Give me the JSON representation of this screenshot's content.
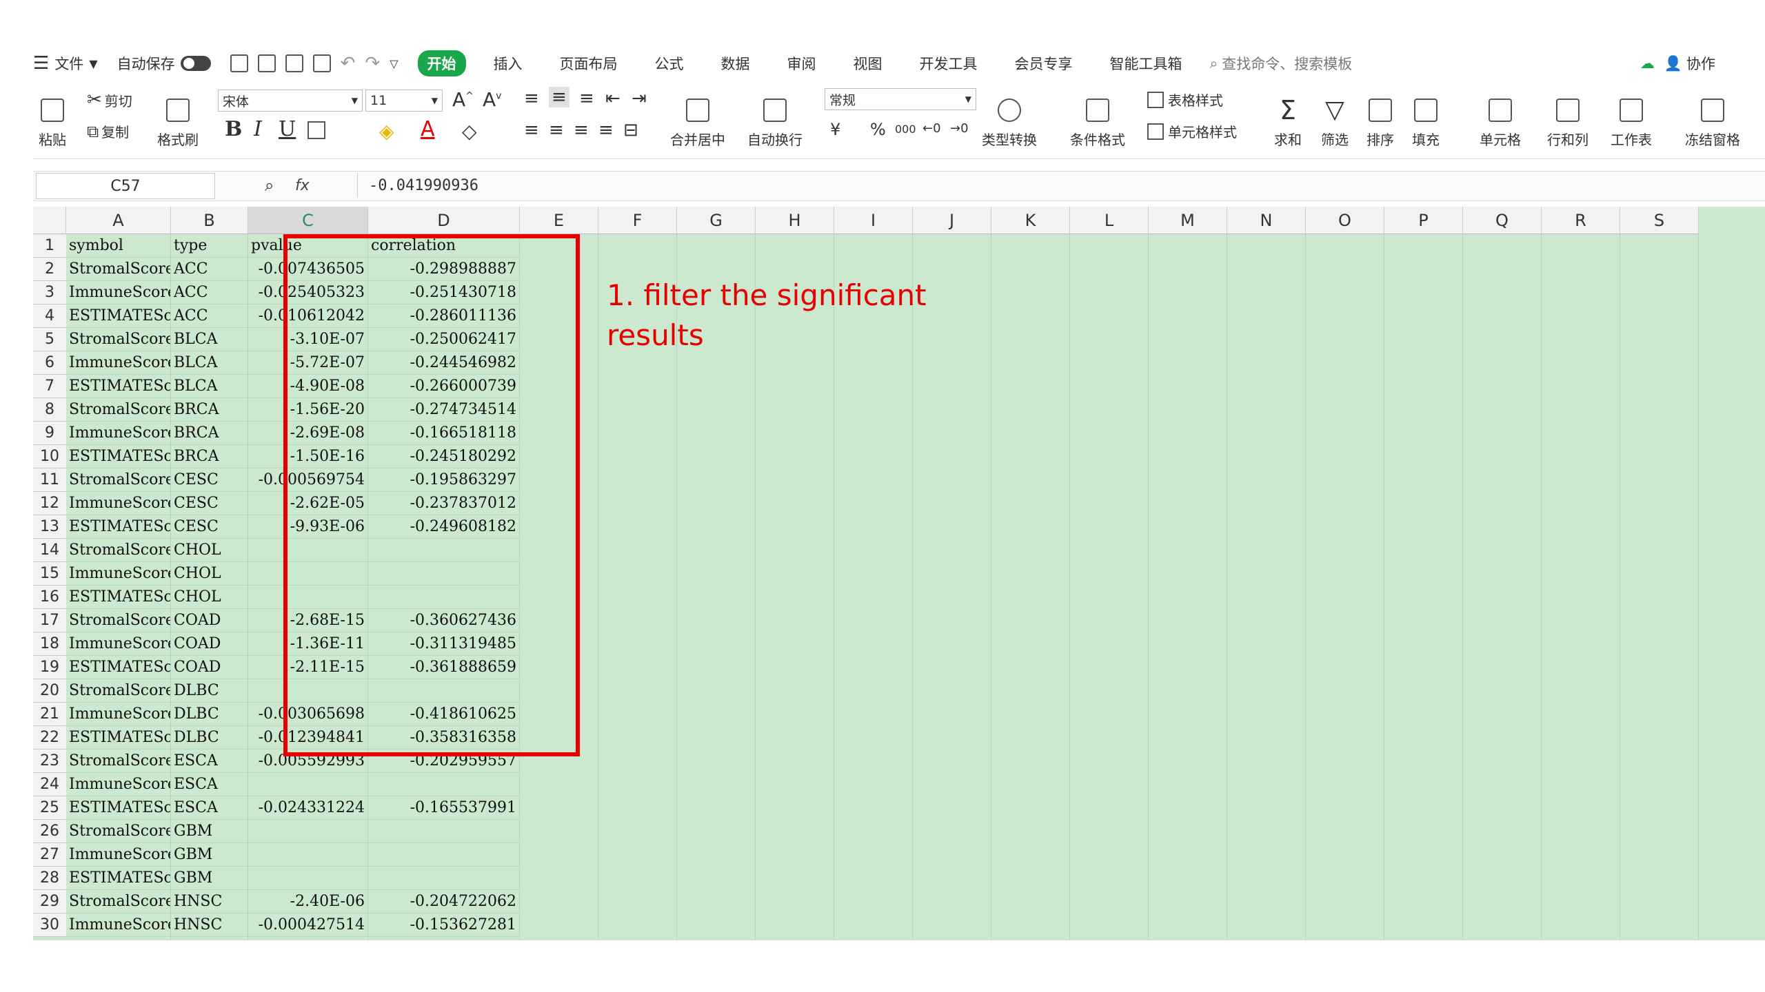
{
  "menu": {
    "file_label": "文件",
    "autosave_label": "自动保存",
    "tabs": [
      "开始",
      "插入",
      "页面布局",
      "公式",
      "数据",
      "审阅",
      "视图",
      "开发工具",
      "会员专享",
      "智能工具箱"
    ],
    "search_placeholder": "查找命令、搜索模板",
    "collab_label": "协作"
  },
  "ribbon": {
    "paste": "粘贴",
    "cut": "剪切",
    "copy": "复制",
    "format_painter": "格式刷",
    "font_name": "宋体",
    "font_size": "11",
    "merge_center": "合并居中",
    "wrap_text": "自动换行",
    "number_format": "常规",
    "type_convert": "类型转换",
    "conditional_format": "条件格式",
    "table_style": "表格样式",
    "cell_style": "单元格样式",
    "sum": "求和",
    "filter": "筛选",
    "sort": "排序",
    "fill": "填充",
    "cell": "单元格",
    "row_col": "行和列",
    "worksheet": "工作表",
    "freeze": "冻结窗格",
    "bold": "B",
    "italic": "I",
    "underline": "U",
    "currency": "¥",
    "percent": "%",
    "thousands": "000"
  },
  "formula_bar": {
    "cell_ref": "C57",
    "fx": "fx",
    "value": "-0.041990936"
  },
  "columns": [
    "A",
    "B",
    "C",
    "D",
    "E",
    "F",
    "G",
    "H",
    "I",
    "J",
    "K",
    "L",
    "M",
    "N",
    "O",
    "P",
    "Q",
    "R",
    "S"
  ],
  "rows": [
    {
      "n": "1",
      "a": "symbol",
      "b": "type",
      "c": "pvalue",
      "d": "correlation"
    },
    {
      "n": "2",
      "a": "StromalScore",
      "b": "ACC",
      "c": "-0.007436505",
      "d": "-0.298988887"
    },
    {
      "n": "3",
      "a": "ImmuneScore",
      "b": "ACC",
      "c": "-0.025405323",
      "d": "-0.251430718"
    },
    {
      "n": "4",
      "a": "ESTIMATEScore",
      "b": "ACC",
      "c": "-0.010612042",
      "d": "-0.286011136"
    },
    {
      "n": "5",
      "a": "StromalScore",
      "b": "BLCA",
      "c": "-3.10E-07",
      "d": "-0.250062417"
    },
    {
      "n": "6",
      "a": "ImmuneScore",
      "b": "BLCA",
      "c": "-5.72E-07",
      "d": "-0.244546982"
    },
    {
      "n": "7",
      "a": "ESTIMATEScore",
      "b": "BLCA",
      "c": "-4.90E-08",
      "d": "-0.266000739"
    },
    {
      "n": "8",
      "a": "StromalScore",
      "b": "BRCA",
      "c": "-1.56E-20",
      "d": "-0.274734514"
    },
    {
      "n": "9",
      "a": "ImmuneScore",
      "b": "BRCA",
      "c": "-2.69E-08",
      "d": "-0.166518118"
    },
    {
      "n": "10",
      "a": "ESTIMATEScore",
      "b": "BRCA",
      "c": "-1.50E-16",
      "d": "-0.245180292"
    },
    {
      "n": "11",
      "a": "StromalScore",
      "b": "CESC",
      "c": "-0.000569754",
      "d": "-0.195863297"
    },
    {
      "n": "12",
      "a": "ImmuneScore",
      "b": "CESC",
      "c": "-2.62E-05",
      "d": "-0.237837012"
    },
    {
      "n": "13",
      "a": "ESTIMATEScore",
      "b": "CESC",
      "c": "-9.93E-06",
      "d": "-0.249608182"
    },
    {
      "n": "14",
      "a": "StromalScore",
      "b": "CHOL",
      "c": "",
      "d": ""
    },
    {
      "n": "15",
      "a": "ImmuneScore",
      "b": "CHOL",
      "c": "",
      "d": ""
    },
    {
      "n": "16",
      "a": "ESTIMATEScore",
      "b": "CHOL",
      "c": "",
      "d": ""
    },
    {
      "n": "17",
      "a": "StromalScore",
      "b": "COAD",
      "c": "-2.68E-15",
      "d": "-0.360627436"
    },
    {
      "n": "18",
      "a": "ImmuneScore",
      "b": "COAD",
      "c": "-1.36E-11",
      "d": "-0.311319485"
    },
    {
      "n": "19",
      "a": "ESTIMATEScore",
      "b": "COAD",
      "c": "-2.11E-15",
      "d": "-0.361888659"
    },
    {
      "n": "20",
      "a": "StromalScore",
      "b": "DLBC",
      "c": "",
      "d": ""
    },
    {
      "n": "21",
      "a": "ImmuneScore",
      "b": "DLBC",
      "c": "-0.003065698",
      "d": "-0.418610625"
    },
    {
      "n": "22",
      "a": "ESTIMATEScore",
      "b": "DLBC",
      "c": "-0.012394841",
      "d": "-0.358316358"
    },
    {
      "n": "23",
      "a": "StromalScore",
      "b": "ESCA",
      "c": "-0.005592993",
      "d": "-0.202959557"
    },
    {
      "n": "24",
      "a": "ImmuneScore",
      "b": "ESCA",
      "c": "",
      "d": ""
    },
    {
      "n": "25",
      "a": "ESTIMATEScore",
      "b": "ESCA",
      "c": "-0.024331224",
      "d": "-0.165537991"
    },
    {
      "n": "26",
      "a": "StromalScore",
      "b": "GBM",
      "c": "",
      "d": ""
    },
    {
      "n": "27",
      "a": "ImmuneScore",
      "b": "GBM",
      "c": "",
      "d": ""
    },
    {
      "n": "28",
      "a": "ESTIMATEScore",
      "b": "GBM",
      "c": "",
      "d": ""
    },
    {
      "n": "29",
      "a": "StromalScore",
      "b": "HNSC",
      "c": "-2.40E-06",
      "d": "-0.204722062"
    },
    {
      "n": "30",
      "a": "ImmuneScore",
      "b": "HNSC",
      "c": "-0.000427514",
      "d": "-0.153627281"
    }
  ],
  "annotation": {
    "line1": "1. filter the significant",
    "line2": "results"
  },
  "colors": {
    "accent": "#1aa64b",
    "sheet_bg": "#cce8cf",
    "highlight": "#e60000"
  }
}
